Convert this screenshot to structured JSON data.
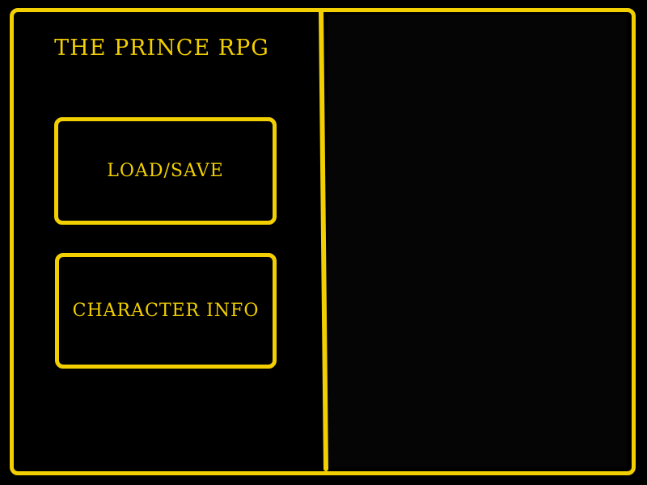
{
  "game": {
    "title": "THE PRINCE RPG"
  },
  "menu": {
    "load_save_label": "LOAD/SAVE",
    "character_info_label": "CHARACTER INFO"
  },
  "theme": {
    "accent": "#f2cf00",
    "background": "#000000"
  }
}
